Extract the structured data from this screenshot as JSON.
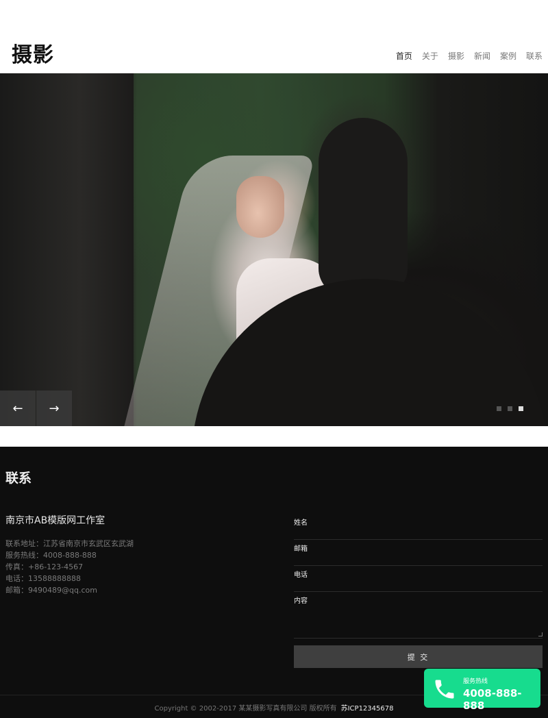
{
  "header": {
    "logo": "摄影",
    "nav": [
      {
        "label": "首页",
        "active": true
      },
      {
        "label": "关于",
        "active": false
      },
      {
        "label": "摄影",
        "active": false
      },
      {
        "label": "新闻",
        "active": false
      },
      {
        "label": "案例",
        "active": false
      },
      {
        "label": "联系",
        "active": false
      }
    ]
  },
  "hero": {
    "prev_label": "←",
    "next_label": "→",
    "slide_count": 3,
    "active_slide": 3
  },
  "contact": {
    "title": "联系",
    "company": "南京市AB模版网工作室",
    "info": [
      "联系地址：江苏省南京市玄武区玄武湖",
      "服务热线：4008-888-888",
      "传真：+86-123-4567",
      "电话：13588888888",
      "邮箱：9490489@qq.com"
    ],
    "form": {
      "name_label": "姓名",
      "email_label": "邮箱",
      "phone_label": "电话",
      "content_label": "内容",
      "submit_label": "提 交"
    }
  },
  "footer": {
    "copyright": "Copyright © 2002-2017 某某摄影写真有限公司 版权所有",
    "icp": "苏ICP12345678"
  },
  "hotline": {
    "label": "服务热线",
    "number": "4008-888-888",
    "icon": "phone-icon",
    "color": "#17dc8e"
  }
}
